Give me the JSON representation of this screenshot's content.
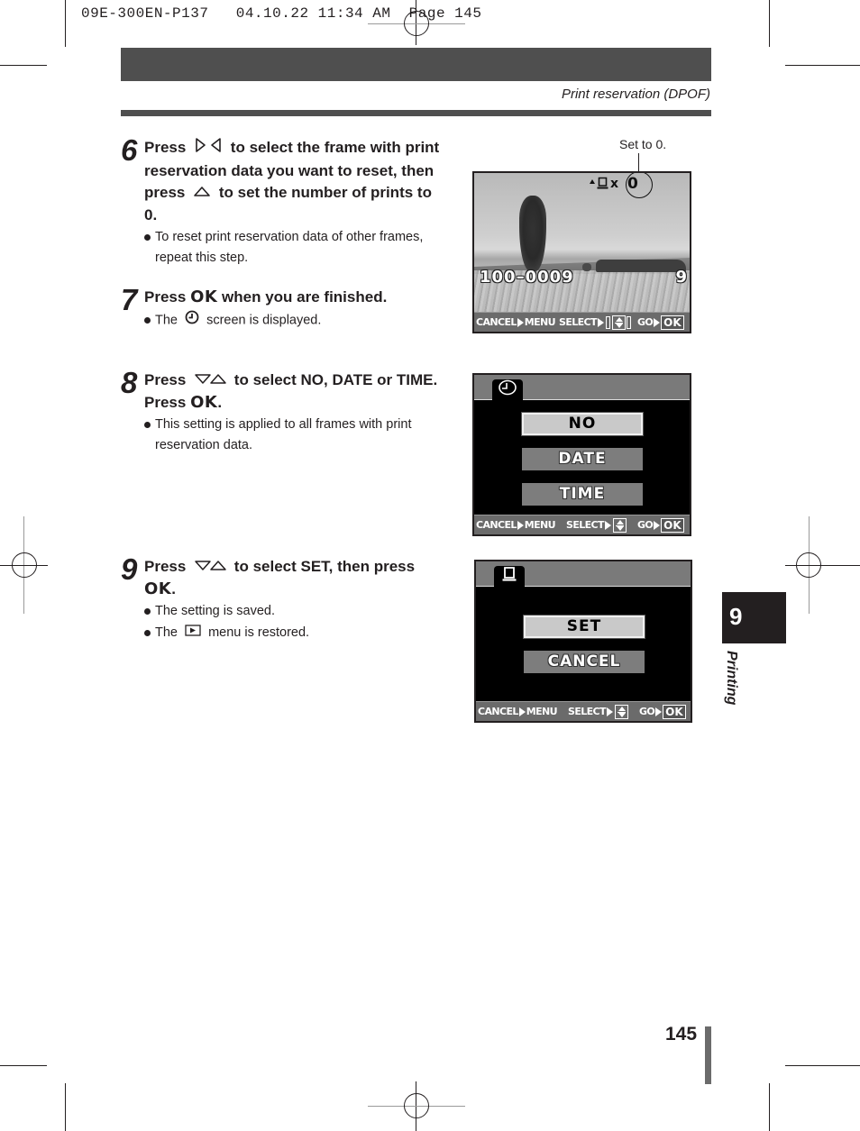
{
  "slug": "09E-300EN-P137   04.10.22 11:34 AM  Page 145",
  "header": {
    "section_title": "Print reservation (DPOF)"
  },
  "steps": [
    {
      "number": "6",
      "head_parts": [
        "Press",
        "to select the frame with print reservation data you want to reset, then press",
        "to set the number of prints to 0."
      ],
      "icons": [
        "right-left-arrow-buttons-icon",
        "up-arrow-button-icon"
      ],
      "bullets": [
        "To reset print reservation data of other frames, repeat this step."
      ]
    },
    {
      "number": "7",
      "head_parts": [
        "Press",
        "OK",
        "when you are finished."
      ],
      "bullets_parts": [
        [
          "The",
          "screen is displayed."
        ]
      ],
      "icons": [
        "clock-icon"
      ]
    },
    {
      "number": "8",
      "head_parts": [
        "Press",
        "to select NO, DATE or TIME. Press",
        "OK",
        "."
      ],
      "icons": [
        "down-up-arrow-buttons-icon"
      ],
      "bullets": [
        "This setting is applied to all frames with print reservation data."
      ]
    },
    {
      "number": "9",
      "head_parts": [
        "Press",
        "to select SET, then press",
        "OK",
        "."
      ],
      "icons": [
        "down-up-arrow-buttons-icon"
      ],
      "bullets": [
        "The setting is saved."
      ],
      "bullets_parts": [
        [
          "The",
          "menu is restored."
        ]
      ]
    }
  ],
  "screen1": {
    "callout": "Set to 0.",
    "print_count_prefix": "x",
    "print_count": "0",
    "file_number": "100–0009",
    "frame_number": "9",
    "footer": {
      "cancel": "CANCEL",
      "menu": "MENU",
      "select": "SELECT",
      "go": "GO",
      "ok": "OK"
    }
  },
  "screen2": {
    "tab_icon": "clock-icon",
    "items": [
      {
        "label": "NO",
        "selected": true
      },
      {
        "label": "DATE",
        "selected": false
      },
      {
        "label": "TIME",
        "selected": false
      }
    ],
    "footer": {
      "cancel": "CANCEL",
      "menu": "MENU",
      "select": "SELECT",
      "go": "GO",
      "ok": "OK"
    }
  },
  "screen3": {
    "tab_icon": "print-icon",
    "items": [
      {
        "label": "SET",
        "selected": true
      },
      {
        "label": "CANCEL",
        "selected": false
      }
    ],
    "footer": {
      "cancel": "CANCEL",
      "menu": "MENU",
      "select": "SELECT",
      "go": "GO",
      "ok": "OK"
    }
  },
  "chapter": {
    "number": "9",
    "label": "Printing"
  },
  "page_number": "145"
}
